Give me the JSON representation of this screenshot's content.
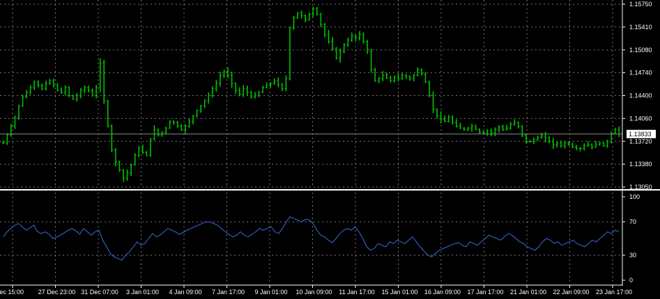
{
  "chart_data": [
    {
      "type": "bar",
      "series": [
        {
          "values": [
            1.137,
            1.1382,
            1.1395,
            1.1408,
            1.1425,
            1.1438,
            1.1445,
            1.1452,
            1.146,
            1.1455,
            1.145,
            1.1458,
            1.1462,
            1.1455,
            1.1448,
            1.1445,
            1.1452,
            1.144,
            1.1435,
            1.144,
            1.1448,
            1.1452,
            1.1447,
            1.144,
            1.1452,
            1.1488,
            1.1432,
            1.1395,
            1.136,
            1.1342,
            1.133,
            1.1318,
            1.1326,
            1.1338,
            1.1352,
            1.1362,
            1.1356,
            1.1352,
            1.1376,
            1.139,
            1.1382,
            1.1386,
            1.1392,
            1.1402,
            1.14,
            1.1395,
            1.139,
            1.1395,
            1.1402,
            1.141,
            1.1418,
            1.1425,
            1.1432,
            1.144,
            1.145,
            1.1458,
            1.147,
            1.1475,
            1.147,
            1.1458,
            1.1448,
            1.1442,
            1.145,
            1.1445,
            1.1438,
            1.144,
            1.1445,
            1.1452,
            1.1455,
            1.1458,
            1.1462,
            1.1456,
            1.145,
            1.1465,
            1.154,
            1.1555,
            1.1562,
            1.1558,
            1.1552,
            1.156,
            1.1568,
            1.156,
            1.1545,
            1.153,
            1.152,
            1.151,
            1.1495,
            1.1505,
            1.1515,
            1.1522,
            1.1528,
            1.1525,
            1.153,
            1.152,
            1.1505,
            1.1478,
            1.1462,
            1.1465,
            1.147,
            1.1466,
            1.1462,
            1.1468,
            1.1465,
            1.147,
            1.1468,
            1.1465,
            1.147,
            1.1478,
            1.1472,
            1.146,
            1.144,
            1.142,
            1.141,
            1.1405,
            1.1402,
            1.1408,
            1.14,
            1.1395,
            1.1392,
            1.139,
            1.1392,
            1.1395,
            1.139,
            1.1386,
            1.1385,
            1.1388,
            1.1385,
            1.139,
            1.1394,
            1.139,
            1.1392,
            1.1398,
            1.14,
            1.1395,
            1.1382,
            1.1372,
            1.1372,
            1.1375,
            1.1378,
            1.138,
            1.1378,
            1.1372,
            1.1368,
            1.137,
            1.1366,
            1.137,
            1.1368,
            1.1364,
            1.1362,
            1.1362,
            1.1366,
            1.1368,
            1.1364,
            1.1368,
            1.137,
            1.1366,
            1.1372,
            1.1385,
            1.139,
            1.1383
          ]
        }
      ],
      "ylim": [
        1.1305,
        1.1575
      ],
      "y_ticks": [
        "1.15750",
        "1.15410",
        "1.15080",
        "1.14740",
        "1.14400",
        "1.14060",
        "1.13720",
        "1.13380",
        "1.13050"
      ],
      "x_ticks": [
        "ec 15:00",
        "27 Dec 23:00",
        "31 Dec 07:00",
        "3 Jan 01:00",
        "4 Jan 09:00",
        "7 Jan 17:00",
        "9 Jan 01:00",
        "10 Jan 09:00",
        "11 Jan 17:00",
        "15 Jan 01:00",
        "16 Jan 09:00",
        "17 Jan 17:00",
        "21 Jan 01:00",
        "22 Jan 09:00",
        "23 Jan 17:00"
      ],
      "current_price": "1.13833",
      "grid": true
    },
    {
      "type": "line",
      "series": [
        {
          "values": [
            52,
            58,
            62,
            66,
            68,
            64,
            60,
            63,
            66,
            58,
            56,
            58,
            55,
            50,
            52,
            54,
            57,
            60,
            62,
            59,
            55,
            62,
            58,
            54,
            58,
            60,
            48,
            40,
            32,
            28,
            26,
            24,
            30,
            34,
            40,
            46,
            42,
            44,
            50,
            56,
            52,
            54,
            58,
            62,
            60,
            58,
            55,
            57,
            60,
            62,
            64,
            66,
            68,
            70,
            70,
            68,
            66,
            62,
            58,
            55,
            52,
            54,
            58,
            54,
            52,
            55,
            58,
            62,
            60,
            62,
            64,
            58,
            56,
            62,
            70,
            76,
            74,
            72,
            70,
            73,
            72,
            68,
            60,
            54,
            52,
            48,
            45,
            50,
            56,
            60,
            62,
            60,
            64,
            58,
            50,
            40,
            36,
            38,
            44,
            42,
            40,
            46,
            44,
            48,
            46,
            44,
            48,
            52,
            46,
            40,
            35,
            30,
            28,
            32,
            36,
            38,
            40,
            42,
            44,
            45,
            42,
            40,
            46,
            44,
            42,
            46,
            50,
            54,
            52,
            50,
            48,
            52,
            56,
            54,
            50,
            46,
            44,
            40,
            38,
            36,
            40,
            46,
            50,
            48,
            44,
            46,
            42,
            44,
            46,
            48,
            44,
            42,
            40,
            44,
            48,
            46,
            50,
            54,
            58,
            56,
            60,
            58
          ]
        }
      ],
      "ylim": [
        0,
        100
      ],
      "y_ticks": [
        "100",
        "70",
        "30",
        "0"
      ],
      "grid": true
    }
  ],
  "colors": {
    "background": "#000000",
    "bars": "#00c000",
    "indicator_line": "#3a6fd8",
    "grid": "#7a7a7a",
    "text": "#ffffff",
    "price_line": "#8c8c8c",
    "price_badge_fill": "#ffffff",
    "price_badge_text": "#000000"
  }
}
